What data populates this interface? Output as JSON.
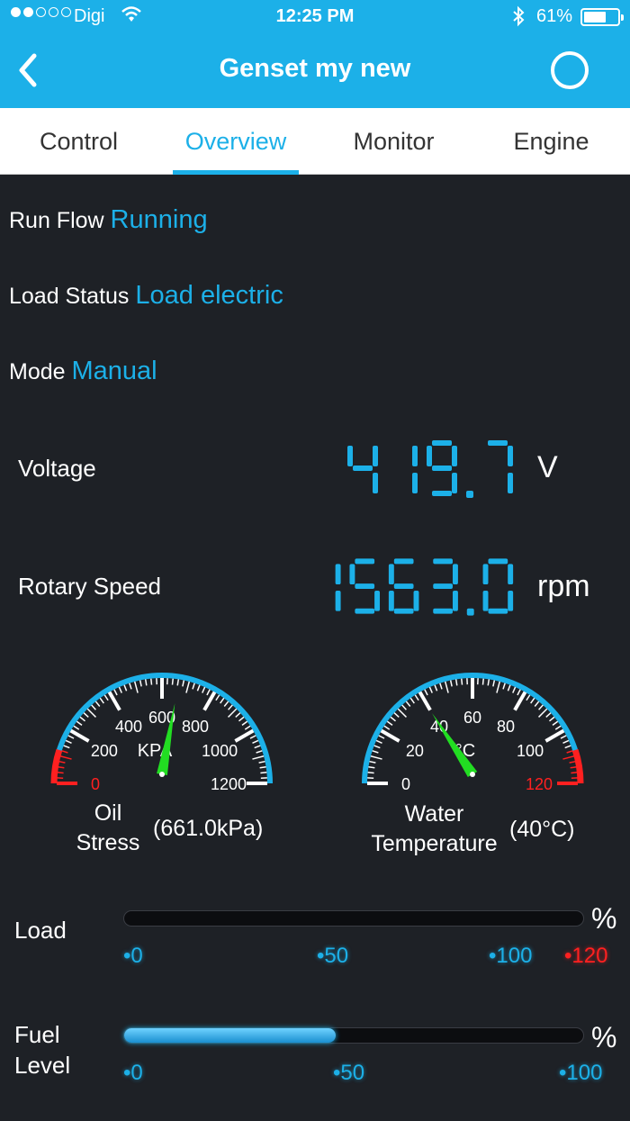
{
  "status_bar": {
    "carrier": "Digi",
    "time": "12:25 PM",
    "battery": "61%",
    "battery_level": 0.61
  },
  "nav": {
    "title": "Genset my new",
    "back_icon": "chevron-left-icon",
    "circle_icon": "circle-icon"
  },
  "tabs": [
    {
      "label": "Control",
      "active": false
    },
    {
      "label": "Overview",
      "active": true
    },
    {
      "label": "Monitor",
      "active": false
    },
    {
      "label": "Engine",
      "active": false
    }
  ],
  "info": {
    "run_flow": {
      "label": "Run Flow",
      "value": "Running"
    },
    "load_status": {
      "label": "Load Status",
      "value": "Load electric"
    },
    "mode": {
      "label": "Mode",
      "value": "Manual"
    }
  },
  "readings": {
    "voltage": {
      "label": "Voltage",
      "value": "419.7",
      "unit": "V"
    },
    "rotary_speed": {
      "label": "Rotary Speed",
      "value": "1563.0",
      "unit": "rpm"
    }
  },
  "gauges": {
    "oil": {
      "name_line1": "Oil",
      "name_line2": "Stress",
      "value_text": "(661.0kPa)",
      "unit_text": "KPA",
      "value": 661.0,
      "min": 0,
      "max": 1200,
      "ticks": [
        "0",
        "200",
        "400",
        "600",
        "800",
        "1000",
        "1200"
      ],
      "red_ticks": [
        "0"
      ]
    },
    "water": {
      "name_line1": "Water",
      "name_line2": "Temperature",
      "value_text": "(40°C)",
      "unit_text": "°C",
      "value": 40,
      "min": 0,
      "max": 120,
      "ticks": [
        "0",
        "20",
        "40",
        "60",
        "80",
        "100",
        "120"
      ],
      "red_ticks": [
        "120"
      ]
    }
  },
  "bars": {
    "load": {
      "label": "Load",
      "unit": "%",
      "value": 0,
      "ticks": [
        "•0",
        "•50",
        "•100",
        "•120"
      ]
    },
    "fuel": {
      "label_line1": "Fuel",
      "label_line2": "Level",
      "unit": "%",
      "value": 46,
      "ticks": [
        "•0",
        "•50",
        "•100"
      ]
    }
  },
  "colors": {
    "accent": "#1cb0e8",
    "background": "#1e2126",
    "needle": "#22dd22",
    "danger": "#ff2020"
  }
}
